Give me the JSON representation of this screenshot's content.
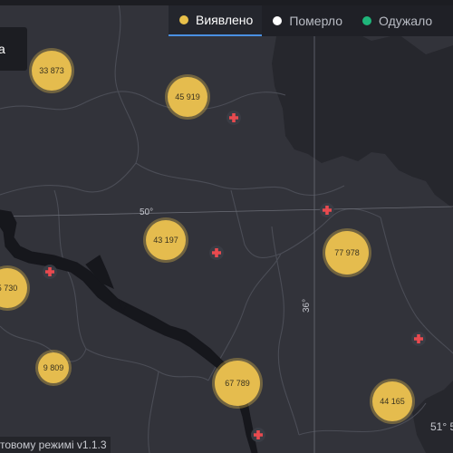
{
  "tabs": [
    {
      "label": "Виявлено",
      "color": "#e8c04a",
      "active": true
    },
    {
      "label": "Померло",
      "color": "#ffffff",
      "active": false
    },
    {
      "label": "Одужало",
      "color": "#1fb57a",
      "active": false
    }
  ],
  "left_card": {
    "text": "a"
  },
  "gridlines": {
    "lat_label": "50°",
    "lon_label": "36°",
    "corner_label": "51° 5"
  },
  "footer": {
    "text": "товому режимі v1.1.3"
  },
  "clusters": [
    {
      "label": "33 873"
    },
    {
      "label": "45 919"
    },
    {
      "label": "43 197"
    },
    {
      "label": "77 978"
    },
    {
      "label": "5 730"
    },
    {
      "label": "9 809"
    },
    {
      "label": "67 789"
    },
    {
      "label": "44 165"
    }
  ],
  "colors": {
    "cluster": "#e5bc4e",
    "water": "#16171c",
    "marker": "#e84a4f"
  }
}
